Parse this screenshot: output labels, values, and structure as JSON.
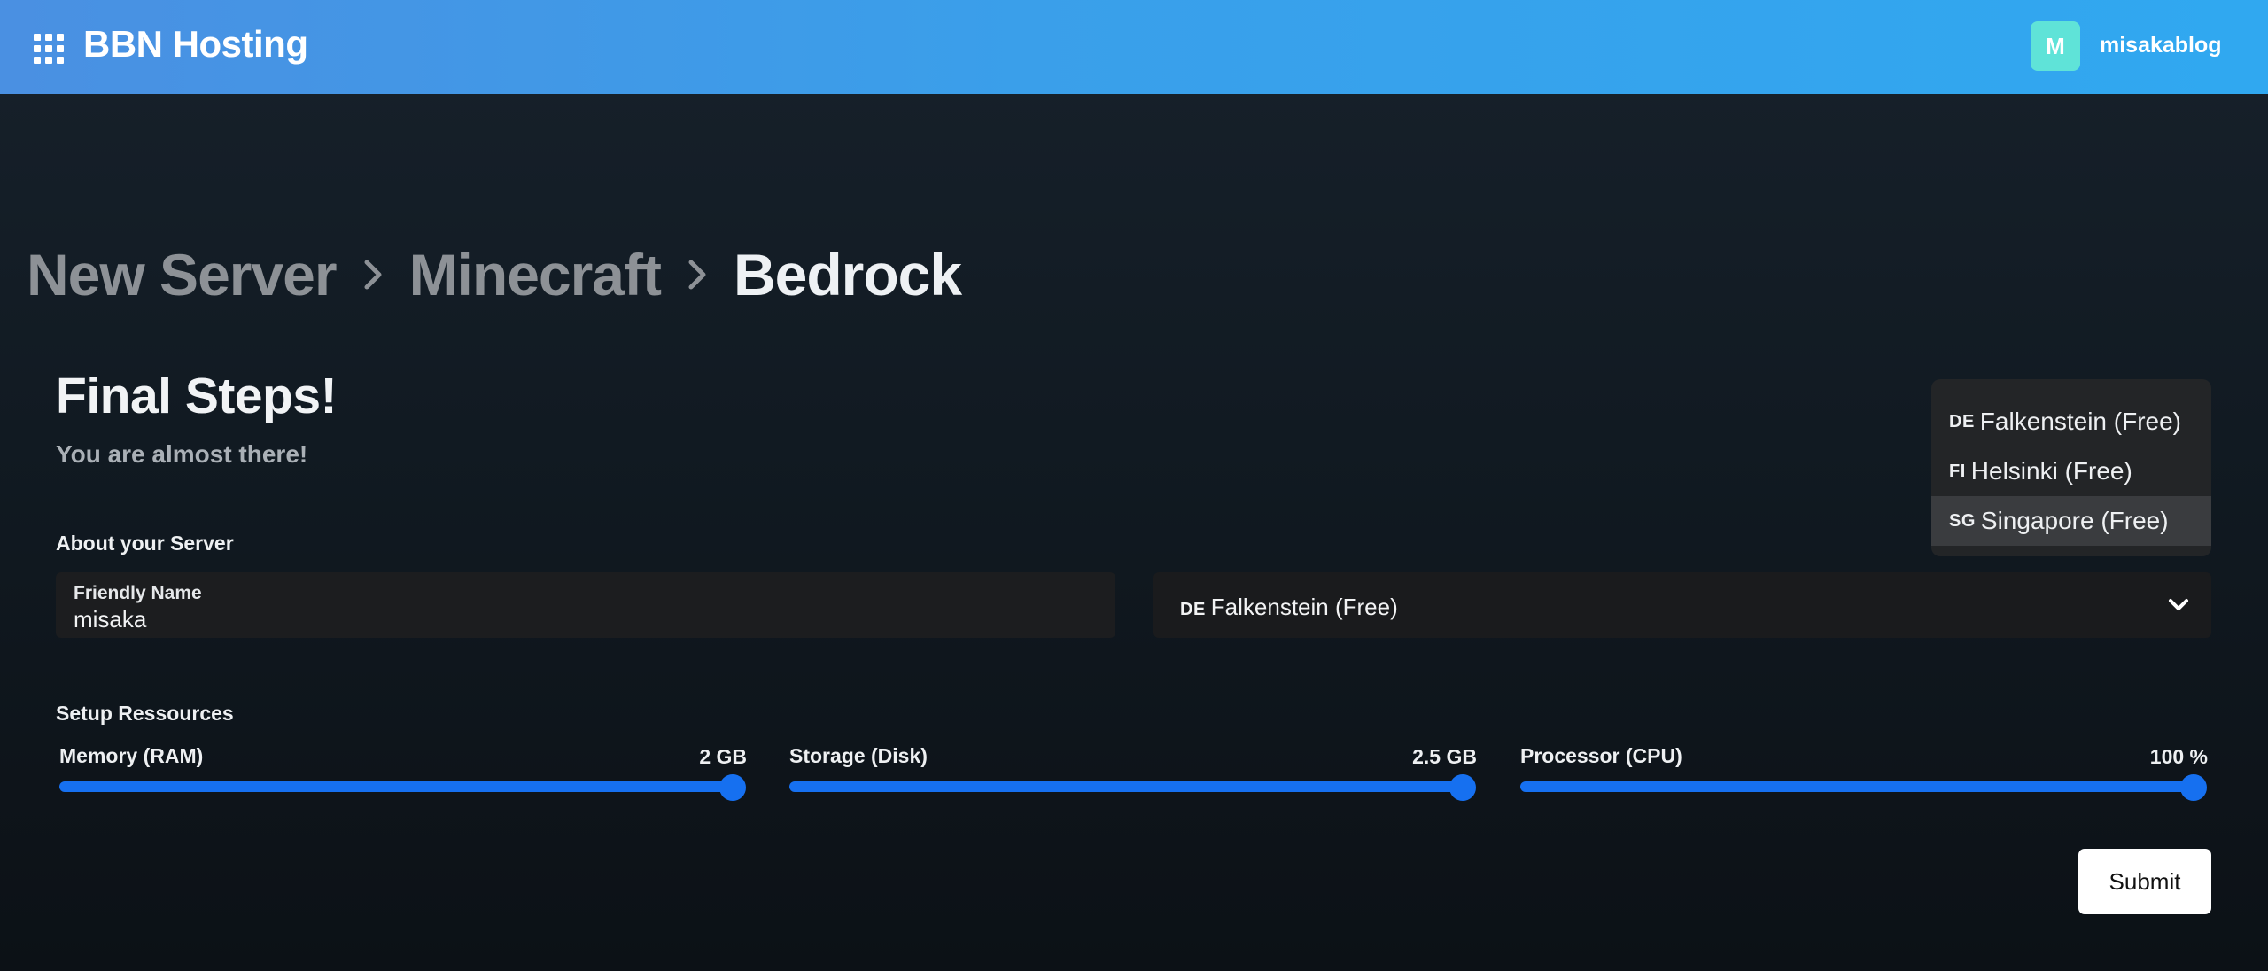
{
  "header": {
    "brand": "BBN Hosting",
    "avatar_letter": "M",
    "username": "misakablog",
    "avatar_color": "#5fe3d8"
  },
  "breadcrumb": [
    "New Server",
    "Minecraft",
    "Bedrock"
  ],
  "heading": {
    "title": "Final Steps!",
    "subtitle": "You are almost there!"
  },
  "about": {
    "section_label": "About your Server",
    "friendly_name_label": "Friendly Name",
    "friendly_name_value": "misaka",
    "location_selected": {
      "flag": "DE",
      "label": "Falkenstein (Free)"
    }
  },
  "location_menu": [
    {
      "flag": "DE",
      "label": "Falkenstein (Free)"
    },
    {
      "flag": "FI",
      "label": "Helsinki (Free)"
    },
    {
      "flag": "SG",
      "label": "Singapore (Free)"
    }
  ],
  "resources": {
    "section_label": "Setup Ressources",
    "sliders": [
      {
        "label": "Memory (RAM)",
        "value": "2 GB",
        "fraction": 1.0
      },
      {
        "label": "Storage (Disk)",
        "value": "2.5 GB",
        "fraction": 1.0
      },
      {
        "label": "Processor (CPU)",
        "value": "100 %",
        "fraction": 1.0
      }
    ]
  },
  "submit_label": "Submit",
  "accent_color": "#1670f0"
}
